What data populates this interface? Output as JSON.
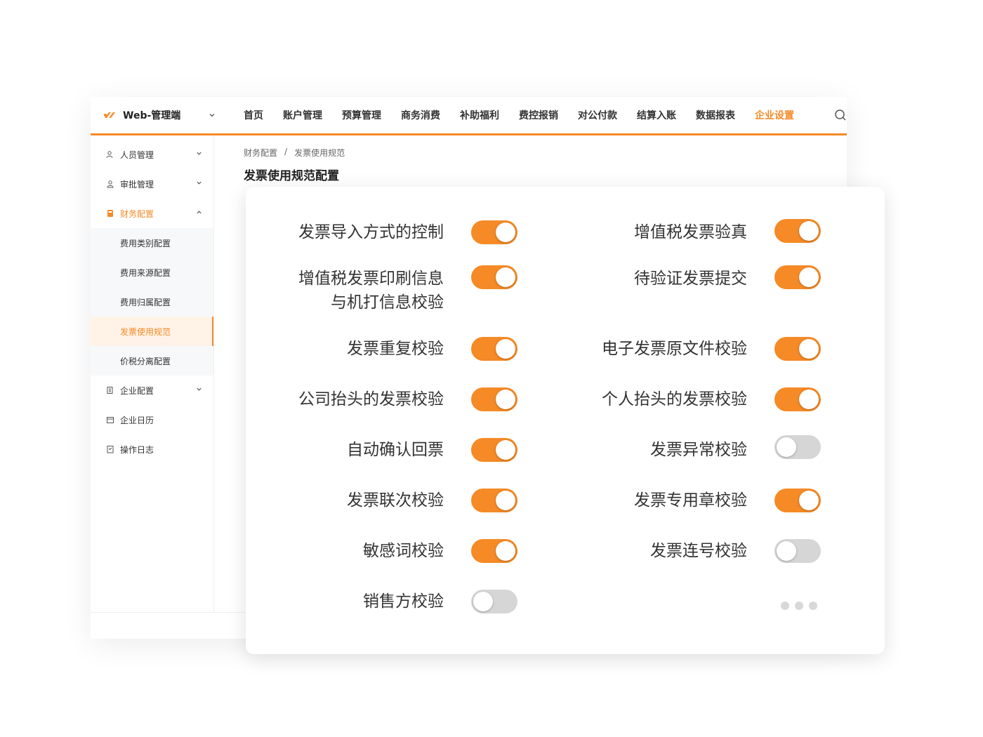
{
  "brand": {
    "name": "Web-管理端",
    "accent": "#f58a26"
  },
  "nav": {
    "items": [
      "首页",
      "账户管理",
      "预算管理",
      "商务消费",
      "补助福利",
      "费控报销",
      "对公付款",
      "结算入账",
      "数据报表",
      "企业设置"
    ],
    "active": "企业设置"
  },
  "sidebar": {
    "items": [
      {
        "label": "人员管理",
        "icon": "users-icon"
      },
      {
        "label": "审批管理",
        "icon": "user-check-icon"
      },
      {
        "label": "财务配置",
        "icon": "finance-icon",
        "open": true
      },
      {
        "label": "企业配置",
        "icon": "building-icon"
      },
      {
        "label": "企业日历",
        "icon": "calendar-icon"
      },
      {
        "label": "操作日志",
        "icon": "log-icon"
      }
    ],
    "submenu": [
      "费用类别配置",
      "费用来源配置",
      "费用归属配置",
      "发票使用规范",
      "价税分离配置"
    ],
    "active_sub": "发票使用规范"
  },
  "breadcrumb": {
    "parent": "财务配置",
    "sep": "/",
    "current": "发票使用规范"
  },
  "page_title": "发票使用规范配置",
  "settings": {
    "left": [
      {
        "label": "发票导入方式的控制",
        "on": true
      },
      {
        "label_line1": "增值税发票印刷信息",
        "label_line2": "与机打信息校验",
        "on": true
      },
      {
        "label": "发票重复校验",
        "on": true
      },
      {
        "label": "公司抬头的发票校验",
        "on": true
      },
      {
        "label": "自动确认回票",
        "on": true
      },
      {
        "label": "发票联次校验",
        "on": true
      },
      {
        "label": "敏感词校验",
        "on": true
      },
      {
        "label": "销售方校验",
        "on": false
      }
    ],
    "right": [
      {
        "label": "增值税发票验真",
        "on": true
      },
      {
        "label": "待验证发票提交",
        "on": true
      },
      {
        "label": "电子发票原文件校验",
        "on": true
      },
      {
        "label": "个人抬头的发票校验",
        "on": true
      },
      {
        "label": "发票异常校验",
        "on": false
      },
      {
        "label": "发票专用章校验",
        "on": true
      },
      {
        "label": "发票连号校验",
        "on": false
      }
    ]
  }
}
